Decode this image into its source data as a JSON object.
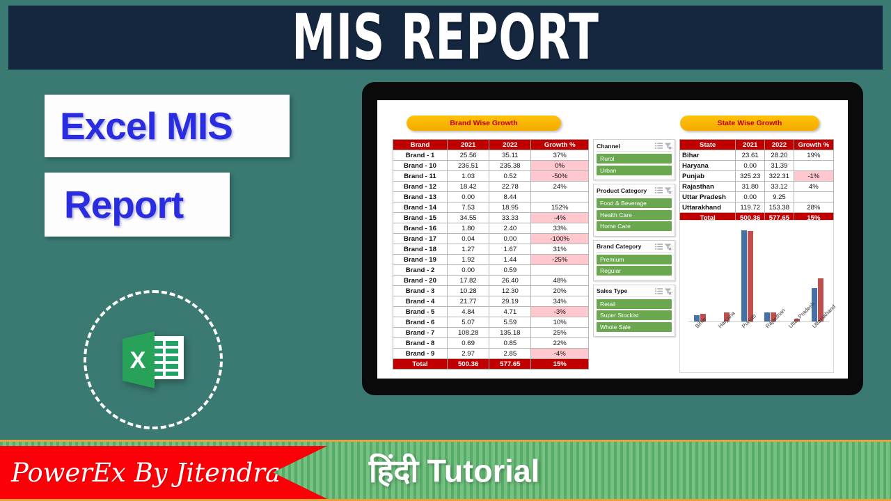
{
  "header": {
    "title": "MIS REPORT",
    "bg": "#15263f"
  },
  "left_panel": {
    "line1": "Excel MIS",
    "line2": "Report",
    "text_color": "#2a2ce0",
    "logo_icon": "excel-logo-icon"
  },
  "dashboard": {
    "brand_section_title": "Brand Wise Growth",
    "state_section_title": "State Wise Growth",
    "brand_table": {
      "columns": [
        "Brand",
        "2021",
        "2022",
        "Growth %"
      ],
      "rows": [
        {
          "name": "Brand - 1",
          "y2021": "25.56",
          "y2022": "35.11",
          "growth": "37%",
          "negative": false
        },
        {
          "name": "Brand - 10",
          "y2021": "236.51",
          "y2022": "235.38",
          "growth": "0%",
          "negative": true
        },
        {
          "name": "Brand - 11",
          "y2021": "1.03",
          "y2022": "0.52",
          "growth": "-50%",
          "negative": true
        },
        {
          "name": "Brand - 12",
          "y2021": "18.42",
          "y2022": "22.78",
          "growth": "24%",
          "negative": false
        },
        {
          "name": "Brand - 13",
          "y2021": "0.00",
          "y2022": "8.44",
          "growth": "",
          "negative": false
        },
        {
          "name": "Brand - 14",
          "y2021": "7.53",
          "y2022": "18.95",
          "growth": "152%",
          "negative": false
        },
        {
          "name": "Brand - 15",
          "y2021": "34.55",
          "y2022": "33.33",
          "growth": "-4%",
          "negative": true
        },
        {
          "name": "Brand - 16",
          "y2021": "1.80",
          "y2022": "2.40",
          "growth": "33%",
          "negative": false
        },
        {
          "name": "Brand - 17",
          "y2021": "0.04",
          "y2022": "0.00",
          "growth": "-100%",
          "negative": true
        },
        {
          "name": "Brand - 18",
          "y2021": "1.27",
          "y2022": "1.67",
          "growth": "31%",
          "negative": false
        },
        {
          "name": "Brand - 19",
          "y2021": "1.92",
          "y2022": "1.44",
          "growth": "-25%",
          "negative": true
        },
        {
          "name": "Brand - 2",
          "y2021": "0.00",
          "y2022": "0.59",
          "growth": "",
          "negative": false
        },
        {
          "name": "Brand - 20",
          "y2021": "17.82",
          "y2022": "26.40",
          "growth": "48%",
          "negative": false
        },
        {
          "name": "Brand - 3",
          "y2021": "10.28",
          "y2022": "12.30",
          "growth": "20%",
          "negative": false
        },
        {
          "name": "Brand - 4",
          "y2021": "21.77",
          "y2022": "29.19",
          "growth": "34%",
          "negative": false
        },
        {
          "name": "Brand - 5",
          "y2021": "4.84",
          "y2022": "4.71",
          "growth": "-3%",
          "negative": true
        },
        {
          "name": "Brand - 6",
          "y2021": "5.07",
          "y2022": "5.59",
          "growth": "10%",
          "negative": false
        },
        {
          "name": "Brand - 7",
          "y2021": "108.28",
          "y2022": "135.18",
          "growth": "25%",
          "negative": false
        },
        {
          "name": "Brand - 8",
          "y2021": "0.69",
          "y2022": "0.85",
          "growth": "22%",
          "negative": false
        },
        {
          "name": "Brand - 9",
          "y2021": "2.97",
          "y2022": "2.85",
          "growth": "-4%",
          "negative": true
        }
      ],
      "total": {
        "name": "Total",
        "y2021": "500.36",
        "y2022": "577.65",
        "growth": "15%"
      }
    },
    "state_table": {
      "columns": [
        "State",
        "2021",
        "2022",
        "Growth %"
      ],
      "rows": [
        {
          "name": "Bihar",
          "y2021": "23.61",
          "y2022": "28.20",
          "growth": "19%",
          "negative": false
        },
        {
          "name": "Haryana",
          "y2021": "0.00",
          "y2022": "31.39",
          "growth": "",
          "negative": false
        },
        {
          "name": "Punjab",
          "y2021": "325.23",
          "y2022": "322.31",
          "growth": "-1%",
          "negative": true
        },
        {
          "name": "Rajasthan",
          "y2021": "31.80",
          "y2022": "33.12",
          "growth": "4%",
          "negative": false
        },
        {
          "name": "Uttar Pradesh",
          "y2021": "0.00",
          "y2022": "9.25",
          "growth": "",
          "negative": false
        },
        {
          "name": "Uttarakhand",
          "y2021": "119.72",
          "y2022": "153.38",
          "growth": "28%",
          "negative": false
        }
      ],
      "total": {
        "name": "Total",
        "y2021": "500.36",
        "y2022": "577.65",
        "growth": "15%"
      }
    },
    "slicers": [
      {
        "title": "Channel",
        "multi_icon": "multi-select-icon",
        "clear_icon": "clear-filter-icon",
        "items": [
          "Rural",
          "Urban"
        ]
      },
      {
        "title": "Product  Category",
        "multi_icon": "multi-select-icon",
        "clear_icon": "clear-filter-icon",
        "items": [
          "Food & Beverage",
          "Health Care",
          "Home Care"
        ]
      },
      {
        "title": "Brand Category",
        "multi_icon": "multi-select-icon",
        "clear_icon": "clear-filter-icon",
        "items": [
          "Premium",
          "Regular"
        ]
      },
      {
        "title": "Sales Type",
        "multi_icon": "multi-select-icon",
        "clear_icon": "clear-filter-icon",
        "items": [
          "Retail",
          "Super Stockist",
          "Whole Sale"
        ]
      }
    ]
  },
  "chart_data": {
    "type": "bar",
    "title": "State Wise Growth",
    "categories": [
      "Bihar",
      "Haryana",
      "Punjab",
      "Rajasthan",
      "Uttar Pradesh",
      "Uttarakhand"
    ],
    "series": [
      {
        "name": "2021",
        "color": "#4472a8",
        "values": [
          23.61,
          0.0,
          325.23,
          31.8,
          0.0,
          119.72
        ]
      },
      {
        "name": "2022",
        "color": "#c0504d",
        "values": [
          28.2,
          31.39,
          322.31,
          33.12,
          9.25,
          153.38
        ]
      }
    ],
    "xlabel": "",
    "ylabel": "",
    "ylim": [
      0,
      340
    ],
    "grid": false,
    "legend": "none"
  },
  "footer": {
    "ribbon_text": "PowerEx By Jitendra",
    "tutorial_text": "हिंदी Tutorial",
    "ribbon_color": "#fb0007",
    "stripe_color": "#56ab68"
  }
}
